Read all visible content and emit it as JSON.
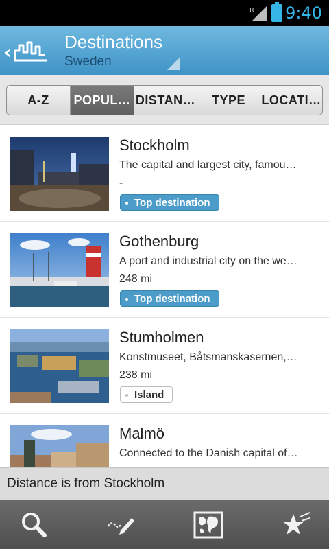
{
  "status": {
    "time": "9:40",
    "roaming": "R"
  },
  "header": {
    "title": "Destinations",
    "subtitle": "Sweden"
  },
  "tabs": [
    {
      "label": "A-Z",
      "active": false
    },
    {
      "label": "POPUL…",
      "active": true
    },
    {
      "label": "DISTAN…",
      "active": false
    },
    {
      "label": "TYPE",
      "active": false
    },
    {
      "label": "LOCATI…",
      "active": false
    }
  ],
  "items": [
    {
      "name": "Stockholm",
      "desc": "The capital and largest city, famou…",
      "dist": "-",
      "tag": "Top destination",
      "tag_style": "top"
    },
    {
      "name": "Gothenburg",
      "desc": "A port and industrial city on the we…",
      "dist": "248 mi",
      "tag": "Top destination",
      "tag_style": "top"
    },
    {
      "name": "Stumholmen",
      "desc": "Konstmuseet, Båtsmanskasernen,…",
      "dist": "238 mi",
      "tag": "Island",
      "tag_style": "island"
    },
    {
      "name": "Malmö",
      "desc": "Connected to the Danish capital of…",
      "dist": "",
      "tag": "",
      "tag_style": ""
    }
  ],
  "note": "Distance is from Stockholm",
  "bottom_bar": [
    "search-icon",
    "pen-icon",
    "map-icon",
    "favorites-icon"
  ],
  "colors": {
    "accent": "#35b4e6",
    "header": "#4a9bcf",
    "tag_blue": "#4b9cc8"
  }
}
